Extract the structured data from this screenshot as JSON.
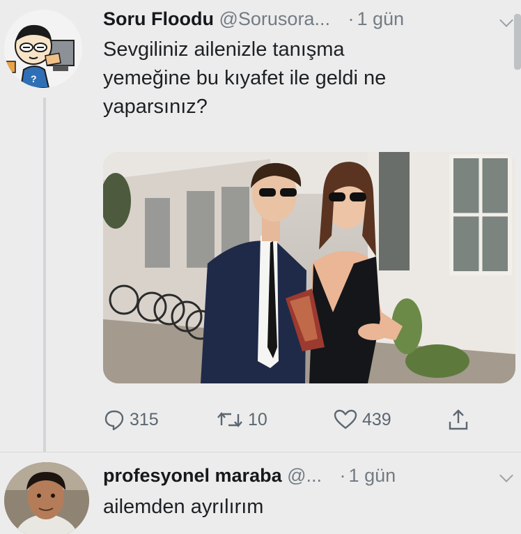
{
  "tweets": [
    {
      "author": {
        "name": "Soru Floodu",
        "handle": "@Sorusora...",
        "avatar_icon": "cartoon-student-avatar-icon"
      },
      "time": "1 gün",
      "text": "Sevgiliniz ailenizle tanışma\nyemeğine bu kıyafet ile geldi ne\nyaparsınız?",
      "media_description_icon": "photo-couple-in-suit-and-black-dress",
      "actions": {
        "reply_count": "315",
        "retweet_count": "10",
        "like_count": "439"
      }
    },
    {
      "author": {
        "name": "profesyonel maraba",
        "handle": "@...",
        "avatar_icon": "profile-photo-avatar-icon"
      },
      "time": "1 gün",
      "text": "ailemden ayrılırım"
    }
  ],
  "colors": {
    "background": "#ececec",
    "text": "#1d2125",
    "secondary": "#737b83",
    "icon": "#5c6670"
  }
}
